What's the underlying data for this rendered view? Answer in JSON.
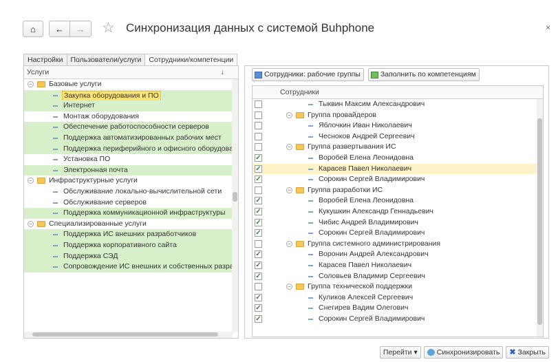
{
  "window": {
    "title": "Синхронизация данных с системой Buhphone",
    "home_icon": "⌂",
    "back_icon": "←",
    "forward_icon": "→",
    "star_icon": "☆",
    "close_icon": "×"
  },
  "tabs": [
    {
      "label": "Настройки"
    },
    {
      "label": "Пользователи/услуги"
    },
    {
      "label": "Сотрудники/компетенции"
    }
  ],
  "left": {
    "column_header": "Услуги",
    "sort_icon": "↓",
    "rows": [
      {
        "text": "Базовые услуги",
        "type": "group",
        "level": 0,
        "selected": false
      },
      {
        "text": "Закупка оборудования и ПО",
        "type": "item",
        "level": 1,
        "selected": true,
        "current": true
      },
      {
        "text": "Интернет",
        "type": "item",
        "level": 1,
        "selected": true
      },
      {
        "text": "Монтаж оборудования",
        "type": "item",
        "level": 1,
        "selected": false
      },
      {
        "text": "Обеспечение работоспособности серверов",
        "type": "item",
        "level": 1,
        "selected": true
      },
      {
        "text": "Поддержка автоматизированных рабочих мест",
        "type": "item",
        "level": 1,
        "selected": true
      },
      {
        "text": "Поддержка периферийного и офисного оборудования",
        "type": "item",
        "level": 1,
        "selected": true
      },
      {
        "text": "Установка ПО",
        "type": "item",
        "level": 1,
        "selected": false
      },
      {
        "text": "Электронная почта",
        "type": "item",
        "level": 1,
        "selected": true
      },
      {
        "text": "Инфраструктурные услуги",
        "type": "group",
        "level": 0,
        "selected": false
      },
      {
        "text": "Обслуживание локально-вычислительной сети",
        "type": "item",
        "level": 1,
        "selected": false
      },
      {
        "text": "Обслуживание серверов",
        "type": "item",
        "level": 1,
        "selected": false
      },
      {
        "text": "Поддержка коммуникационной инфраструктуры",
        "type": "item",
        "level": 1,
        "selected": true
      },
      {
        "text": "Специализированные услуги",
        "type": "group",
        "level": 0,
        "selected": false
      },
      {
        "text": "Поддержка ИС внешних разработчиков",
        "type": "item",
        "level": 1,
        "selected": true
      },
      {
        "text": "Поддержка корпоративного сайта",
        "type": "item",
        "level": 1,
        "selected": true
      },
      {
        "text": "Поддержка СЭД",
        "type": "item",
        "level": 1,
        "selected": true
      },
      {
        "text": "Сопровождение ИС внешних и собственных разработчикс",
        "type": "item",
        "level": 1,
        "selected": true
      }
    ]
  },
  "right": {
    "toolbar": {
      "workgroups_label": "Сотрудники: рабочие группы",
      "fill_label": "Заполнить по компетенциям"
    },
    "column_header": "Сотрудники",
    "rows": [
      {
        "text": "Тыквин Максим Александрович",
        "type": "item",
        "checked": false
      },
      {
        "text": "Группа провайдеров",
        "type": "group",
        "checked": false
      },
      {
        "text": "Яблочкин Иван Николаевич",
        "type": "item",
        "checked": false
      },
      {
        "text": "Чесноков Андрей Сергеевич",
        "type": "item",
        "checked": false
      },
      {
        "text": "Группа развертывания ИС",
        "type": "group",
        "checked": false
      },
      {
        "text": "Воробей Елена Леонидовна",
        "type": "item",
        "checked": true
      },
      {
        "text": "Карасев Павел Николаевич",
        "type": "item",
        "checked": true,
        "highlighted": true
      },
      {
        "text": "Сорокин Сергей Владимирович",
        "type": "item",
        "checked": true
      },
      {
        "text": "Группа разработки ИС",
        "type": "group",
        "checked": false
      },
      {
        "text": "Воробей Елена Леонидовна",
        "type": "item",
        "checked": true
      },
      {
        "text": "Кукушкин Александр Геннадьевич",
        "type": "item",
        "checked": true
      },
      {
        "text": "Чибис Андрей Владимирович",
        "type": "item",
        "checked": true
      },
      {
        "text": "Сорокин Сергей Владимирович",
        "type": "item",
        "checked": true
      },
      {
        "text": "Группа системного администрирования",
        "type": "group",
        "checked": false
      },
      {
        "text": "Воронин Андрей Александрович",
        "type": "item",
        "checked": true
      },
      {
        "text": "Карасев Павел Николаевич",
        "type": "item",
        "checked": true
      },
      {
        "text": "Соловьев Владимир Сергеевич",
        "type": "item",
        "checked": true
      },
      {
        "text": "Группа технической поддержки",
        "type": "group",
        "checked": false
      },
      {
        "text": "Куликов Алексей Сергеевич",
        "type": "item",
        "checked": true
      },
      {
        "text": "Снегирев Вадим Олегович",
        "type": "item",
        "checked": true
      },
      {
        "text": "Сорокин Сергей Владимирович",
        "type": "item",
        "checked": true
      }
    ]
  },
  "footer": {
    "goto_label": "Перейти",
    "sync_label": "Синхронизировать",
    "close_label": "Закрыть"
  },
  "colors": {
    "selected_row": "#d7f0c9",
    "highlight_row": "#fdf2c8",
    "current_cell": "#fbe37a"
  }
}
